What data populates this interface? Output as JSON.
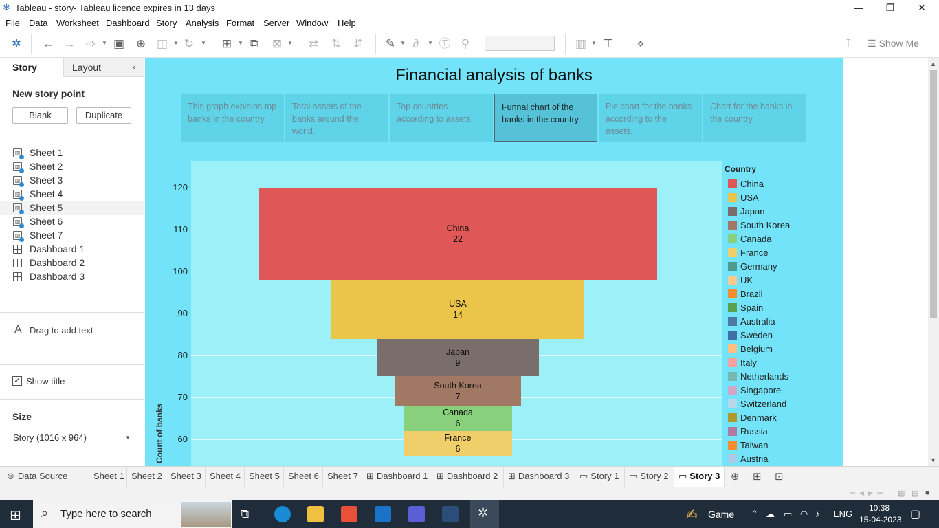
{
  "window": {
    "title": "Tableau - story- Tableau licence expires in 13 days",
    "logo": "❄"
  },
  "menu": [
    "File",
    "Data",
    "Worksheet",
    "Dashboard",
    "Story",
    "Analysis",
    "Format",
    "Server",
    "Window",
    "Help"
  ],
  "toolbar": {
    "show_me": "Show Me"
  },
  "left_pane": {
    "tab_story": "Story",
    "tab_layout": "Layout",
    "new_story_point": "New story point",
    "blank": "Blank",
    "duplicate": "Duplicate",
    "sheets": [
      "Sheet 1",
      "Sheet 2",
      "Sheet 3",
      "Sheet 4",
      "Sheet 5",
      "Sheet 6",
      "Sheet 7",
      "Dashboard 1",
      "Dashboard 2",
      "Dashboard 3"
    ],
    "drag_text": "Drag to add text",
    "text_icon": "A",
    "show_title": "Show title",
    "size_label": "Size",
    "size_value": "Story (1016 x 964)"
  },
  "story": {
    "title": "Financial analysis of banks",
    "points": [
      "This graph explains top banks in the country.",
      "Total assets of the banks around the world.",
      "Top countries according to assets.",
      "Funnal chart of the banks in the country.",
      "Pie chart for the banks according to the assets.",
      "Chart for the banks in the country"
    ],
    "active_point": 3
  },
  "chart_data": {
    "type": "bar",
    "subtype": "funnel",
    "ylabel": "Count of banks",
    "yticks": [
      120,
      110,
      100,
      90,
      80,
      70,
      60
    ],
    "y_view_range": [
      53.6,
      126.4
    ],
    "categories": [
      "China",
      "USA",
      "Japan",
      "South Korea",
      "Canada",
      "France"
    ],
    "values": [
      22,
      14,
      9,
      7,
      6,
      6
    ],
    "cumulative_top": [
      120,
      98,
      84,
      75,
      68,
      62
    ],
    "legend_title": "Country",
    "legend": [
      {
        "name": "China",
        "color": "#e05758"
      },
      {
        "name": "USA",
        "color": "#ebc549"
      },
      {
        "name": "Japan",
        "color": "#796e6b"
      },
      {
        "name": "South Korea",
        "color": "#a07863"
      },
      {
        "name": "Canada",
        "color": "#88d07c"
      },
      {
        "name": "France",
        "color": "#f0ce6a"
      },
      {
        "name": "Germany",
        "color": "#4c9b8c"
      },
      {
        "name": "UK",
        "color": "#fbc88e"
      },
      {
        "name": "Brazil",
        "color": "#f28e2b"
      },
      {
        "name": "Spain",
        "color": "#59a14f"
      },
      {
        "name": "Australia",
        "color": "#4e79a7"
      },
      {
        "name": "Sweden",
        "color": "#3f6fa5"
      },
      {
        "name": "Belgium",
        "color": "#fcbf80"
      },
      {
        "name": "Italy",
        "color": "#f6a0a0"
      },
      {
        "name": "Netherlands",
        "color": "#76b7b2"
      },
      {
        "name": "Singapore",
        "color": "#d2a6c8"
      },
      {
        "name": "Switzerland",
        "color": "#b8d6ea"
      },
      {
        "name": "Denmark",
        "color": "#b09a2d"
      },
      {
        "name": "Russia",
        "color": "#b07aa1"
      },
      {
        "name": "Taiwan",
        "color": "#f28e2b"
      },
      {
        "name": "Austria",
        "color": "#a8cce8"
      }
    ]
  },
  "bottom_tabs": [
    "Data Source",
    "Sheet 1",
    "Sheet 2",
    "Sheet 3",
    "Sheet 4",
    "Sheet 5",
    "Sheet 6",
    "Sheet 7",
    "Dashboard 1",
    "Dashboard 2",
    "Dashboard 3",
    "Story 1",
    "Story 2",
    "Story 3"
  ],
  "active_tab": "Story 3",
  "taskbar": {
    "search_placeholder": "Type here to search",
    "game": "Game",
    "lang": "ENG",
    "time": "10:38",
    "date": "15-04-2023"
  }
}
